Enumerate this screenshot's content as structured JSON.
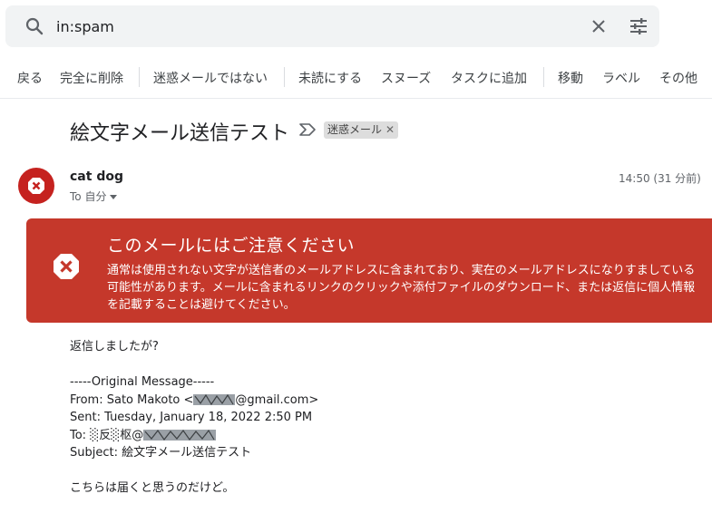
{
  "search": {
    "value": "in:spam"
  },
  "toolbar": {
    "back": "戻る",
    "delete_forever": "完全に削除",
    "not_spam": "迷惑メールではない",
    "mark_unread": "未読にする",
    "snooze": "スヌーズ",
    "add_to_tasks": "タスクに追加",
    "move": "移動",
    "label": "ラベル",
    "more": "その他"
  },
  "email": {
    "subject": "絵文字メール送信テスト",
    "label_chip": "迷惑メール",
    "sender": "cat dog",
    "to": "To 自分",
    "time": "14:50 (31 分前)"
  },
  "warning": {
    "title": "このメールにはご注意ください",
    "body": "通常は使用されない文字が送信者のメールアドレスに含まれており、実在のメールアドレスになりすましている可能性があります。メールに含まれるリンクのクリックや添付ファイルのダウンロード、または返信に個人情報を記載することは避けてください。"
  },
  "message": {
    "line1": "返信しましたが?",
    "original_header": "-----Original Message-----",
    "from_prefix": "From: Sato Makoto <",
    "from_suffix": "@gmail.com>",
    "sent": "Sent: Tuesday, January 18, 2022 2:50 PM",
    "to_prefix": "To: ░反░枢@",
    "subject_line": "Subject: 絵文字メール送信テスト",
    "closing": "こちらは届くと思うのだけど。"
  },
  "colors": {
    "warning_red": "#c5382b",
    "avatar_red": "#c5221f"
  }
}
